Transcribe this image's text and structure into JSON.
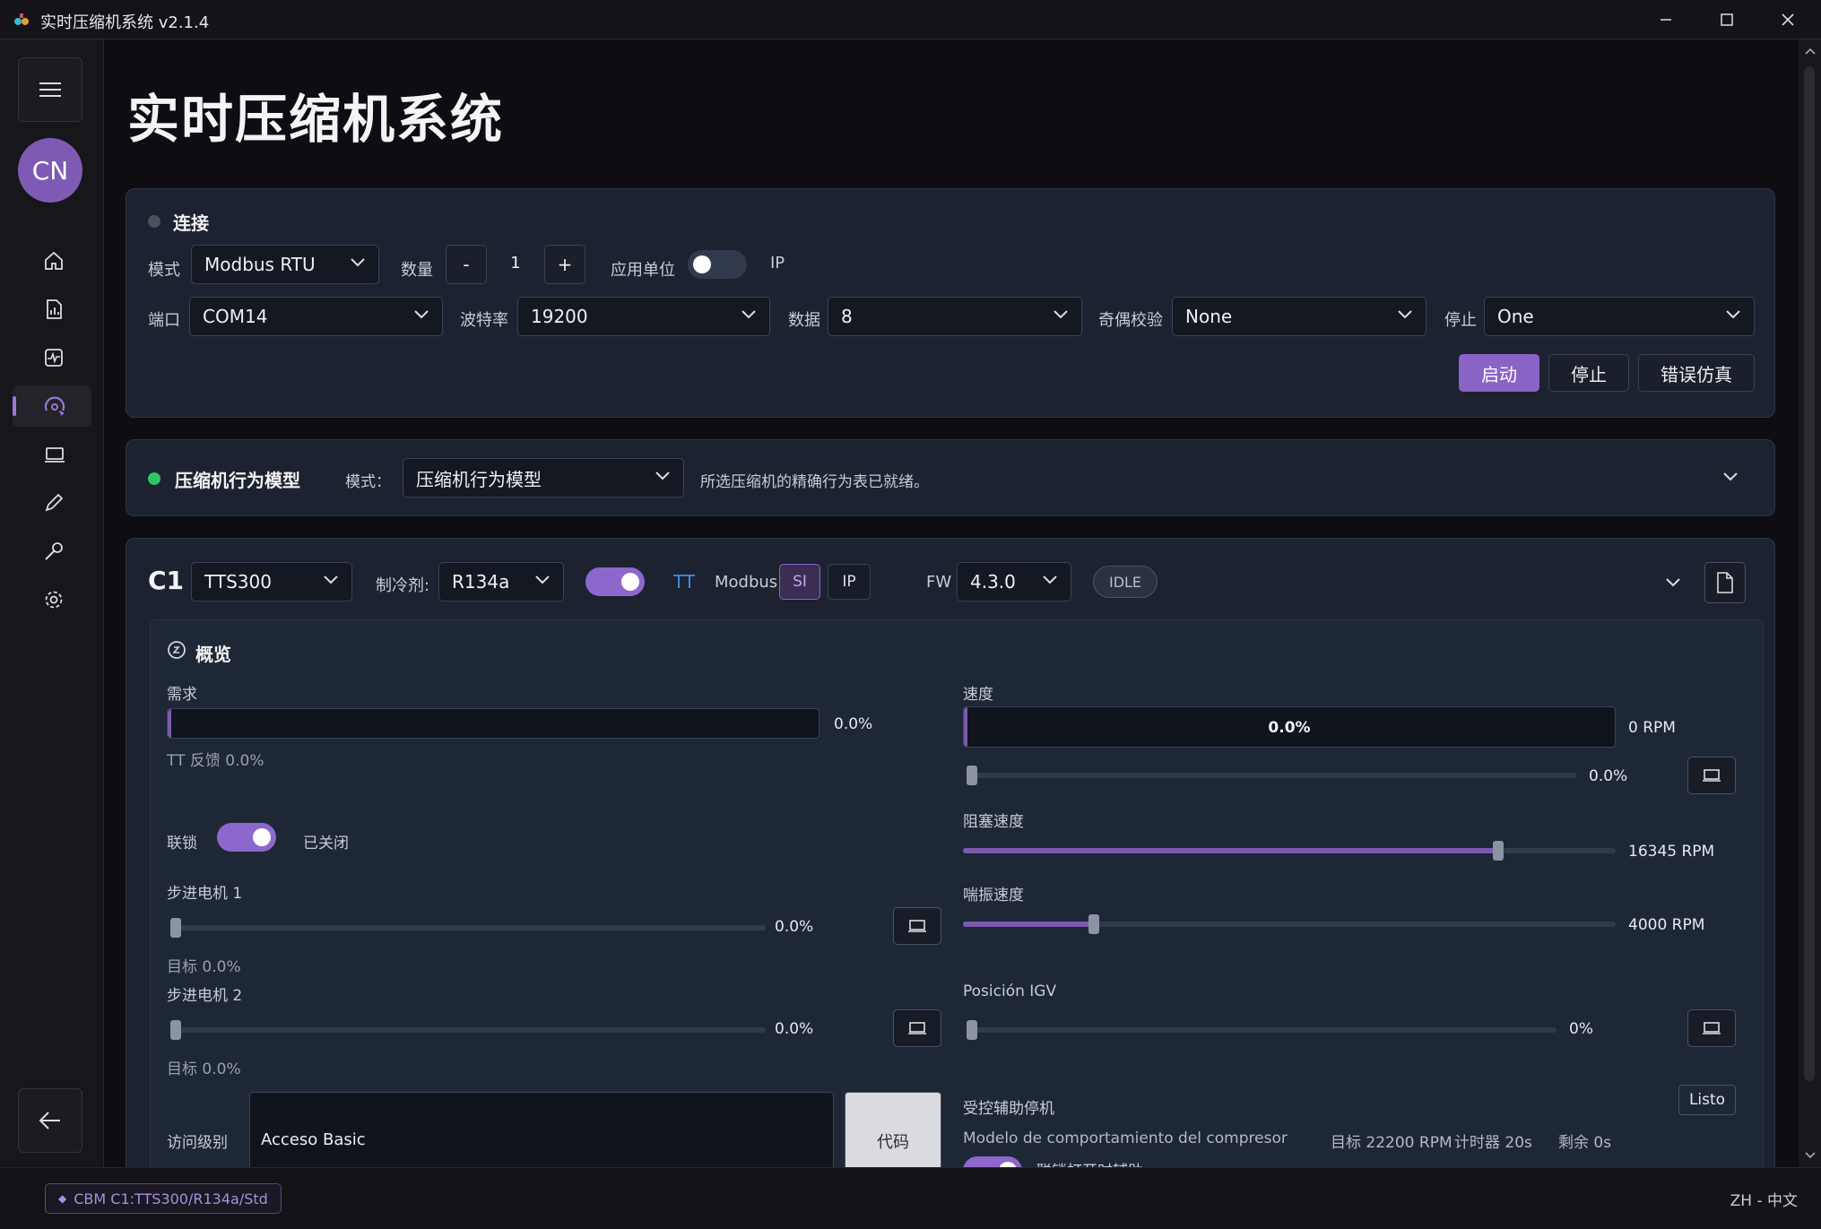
{
  "window": {
    "title": "实时压缩机系统 v2.1.4"
  },
  "sidebar": {
    "avatar_initials": "CN"
  },
  "page": {
    "title": "实时压缩机系统"
  },
  "connection": {
    "heading": "连接",
    "mode_label": "模式",
    "mode_value": "Modbus RTU",
    "count_label": "数量",
    "count_minus": "-",
    "count_value": "1",
    "count_plus": "+",
    "unit_label": "应用单位",
    "unit_ip": "IP",
    "port_label": "端口",
    "port_value": "COM14",
    "baud_label": "波特率",
    "baud_value": "19200",
    "data_label": "数据",
    "data_value": "8",
    "parity_label": "奇偶校验",
    "parity_value": "None",
    "stop_label": "停止",
    "stop_value": "One",
    "start_button": "启动",
    "stop_button": "停止",
    "fault_button": "错误仿真"
  },
  "model": {
    "heading": "压缩机行为模型",
    "mode_label": "模式：",
    "mode_value": "压缩机行为模型",
    "status_text": "所选压缩机的精确行为表已就绪。",
    "status_color": "#2fc46a"
  },
  "compressor": {
    "id": "C1",
    "model_value": "TTS300",
    "refrigerant_label": "制冷剂:",
    "refrigerant_value": "R134a",
    "tt_label": "TT",
    "modbus_label": "Modbus",
    "si_label": "SI",
    "ip_label": "IP",
    "fw_label": "FW",
    "fw_value": "4.3.0",
    "state_badge": "IDLE",
    "overview": {
      "heading": "概览",
      "demand_label": "需求",
      "demand_value": "0.0%",
      "demand_fraction": 0.0,
      "tt_feedback": "TT 反馈 0.0%",
      "speed_label": "速度",
      "speed_value": "0.0%",
      "speed_rpm": "0 RPM",
      "speed_slider_value": "0.0%",
      "speed_fraction": 0.0,
      "interlock_label": "联锁",
      "interlock_state": "已关闭",
      "choke_label": "阻塞速度",
      "choke_value": "16345 RPM",
      "choke_fraction": 0.82,
      "surge_label": "喘振速度",
      "surge_value": "4000 RPM",
      "surge_fraction": 0.2,
      "stepper1_label": "步进电机 1",
      "stepper1_value": "0.0%",
      "stepper1_target": "目标 0.0%",
      "stepper2_label": "步进电机 2",
      "stepper2_value": "0.0%",
      "stepper2_target": "目标 0.0%",
      "igv_label": "Posición IGV",
      "igv_value": "0%",
      "access_label": "访问级别",
      "access_value": "Acceso Basic",
      "code_button": "代码",
      "aux_stop_label": "受控辅助停机",
      "aux_ready": "Listo",
      "aux_model": "Modelo de comportamiento del compresor",
      "aux_target": "目标 22200 RPM",
      "aux_timer": "计时器 20s",
      "aux_remaining": "剩余 0s",
      "aux_cut_text": "联锁打开时辅助"
    }
  },
  "statusbar": {
    "chip": "CBM C1:TTS300/R134a/Std",
    "language": "ZH - 中文"
  },
  "colors": {
    "accent": "#8a63c7",
    "card": "#1c2230",
    "background": "#0e0e12"
  }
}
